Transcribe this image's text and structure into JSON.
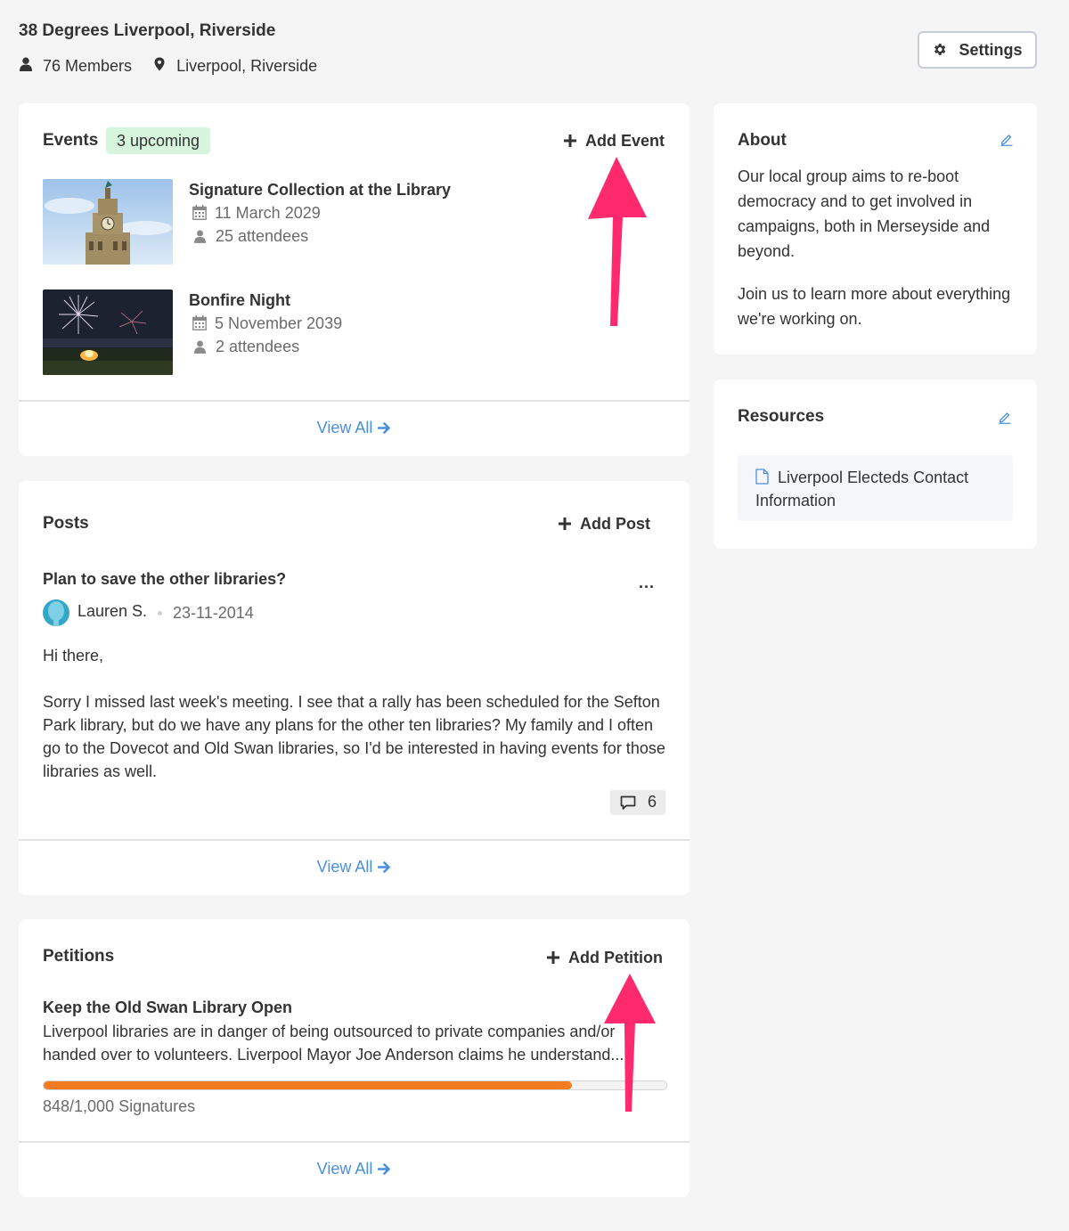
{
  "group": {
    "name": "38 Degrees Liverpool, Riverside",
    "members": "76 Members",
    "location": "Liverpool, Riverside",
    "settings_label": "Settings"
  },
  "events": {
    "title": "Events",
    "badge": "3 upcoming",
    "add_label": "Add Event",
    "items": [
      {
        "title": "Signature Collection at the Library",
        "date": "11 March 2029",
        "attendees": "25 attendees"
      },
      {
        "title": "Bonfire Night",
        "date": "5 November 2039",
        "attendees": "2 attendees"
      }
    ],
    "view_all": "View All"
  },
  "posts": {
    "title": "Posts",
    "add_label": "Add Post",
    "item": {
      "title": "Plan to save the other libraries?",
      "author": "Lauren S.",
      "date": "23-11-2014",
      "greeting": "Hi there,",
      "body": "Sorry I missed last week's meeting. I see that a rally has been scheduled for the Sefton Park library, but do we have any plans for the other ten libraries? My family and I often go to the Dovecot and Old Swan libraries, so I'd be interested in having events for those libraries as well.",
      "comments": "6",
      "more": "..."
    },
    "view_all": "View All"
  },
  "petitions": {
    "title": "Petitions",
    "add_label": "Add Petition",
    "item": {
      "title": "Keep the Old Swan Library Open",
      "description": "Liverpool libraries are in danger of being outsourced to private companies and/or handed over to volunteers.  Liverpool Mayor Joe Anderson claims he understand...",
      "progress": 0.848,
      "signatures": "848/1,000 Signatures"
    },
    "view_all": "View All"
  },
  "about": {
    "title": "About",
    "p1": "Our local group aims to re-boot democracy and to get involved in campaigns, both in Merseyside and beyond.",
    "p2": "Join us to learn more about everything we're working on."
  },
  "resources": {
    "title": "Resources",
    "items": [
      {
        "label": "Liverpool Electeds Contact Information"
      }
    ]
  },
  "colors": {
    "accent_link": "#4a8fe0",
    "badge_bg": "#d7f5dc",
    "progress": "#f47b20",
    "annotation_arrow": "#ff2a6d"
  },
  "icons": [
    "user-icon",
    "map-pin-icon",
    "gear-icon",
    "plus-icon",
    "calendar-icon",
    "arrow-right-icon",
    "pencil-icon",
    "document-icon",
    "comment-icon",
    "avatar"
  ]
}
